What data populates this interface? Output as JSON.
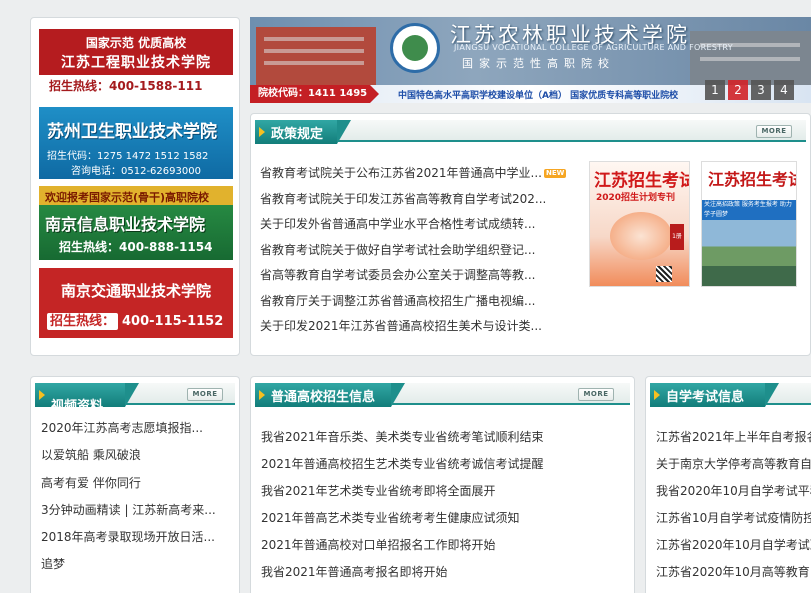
{
  "ads": [
    {
      "line1": "国家示范  优质高校",
      "line2": "江苏工程职业技术学院",
      "line3": "招生热线：400-1588-111"
    },
    {
      "line1": "苏州卫生职业技术学院",
      "line2": "招生代码：1275 1472 1512 1582",
      "line3": "咨询电话：0512-62693000"
    },
    {
      "line1": "欢迎报考国家示范(骨干)高职院校",
      "line2": "南京信息职业技术学院",
      "line3": "招生热线：400-888-1154"
    },
    {
      "line1": "南京交通职业技术学院",
      "line3_tag": "招生热线：",
      "line3": "400-115-1152"
    }
  ],
  "banner": {
    "title_cn": "江苏农林职业技术学院",
    "title_en": "JIANGSU VOCATIONAL COLLEGE OF AGRICULTURE AND FORESTRY",
    "subtitle": "国家示范性高职院校",
    "code_label": "院校代码：1411 1495",
    "tagline": "中国特色高水平高职学校建设单位（A档）   国家优质专科高等职业院校",
    "pages": [
      "1",
      "2",
      "3",
      "4"
    ],
    "active_page": "2"
  },
  "policy": {
    "title": "政策规定",
    "more": "MORE",
    "items": [
      "省教育考试院关于公布江苏省2021年普通高中学业...",
      "省教育考试院关于印发江苏省高等教育自学考试202...",
      "关于印发外省普通高中学业水平合格性考试成绩转...",
      "省教育考试院关于做好自学考试社会助学组织登记...",
      "省高等教育自学考试委员会办公室关于调整高等教...",
      "省教育厅关于调整江苏省普通高校招生广播电视编...",
      "关于印发2021年江苏省普通高校招生美术与设计类..."
    ],
    "new_badge": "NEW",
    "magazine1": {
      "title": "江苏招生考试",
      "year": "2020招生计划专刊",
      "badge": "1册"
    },
    "magazine2": {
      "title": "江苏招生考试",
      "band": "关注高招政策  服务考生报考  助力学子圆梦"
    }
  },
  "video": {
    "title": "视频资料",
    "more": "MORE",
    "items": [
      "2020年江苏高考志愿填报指...",
      "以爱筑船 乘风破浪",
      "高考有爱 伴你同行",
      "3分钟动画精读 | 江苏新高考来...",
      "2018年高考录取现场开放日活...",
      "追梦"
    ]
  },
  "general": {
    "title": "普通高校招生信息",
    "more": "MORE",
    "items": [
      "我省2021年音乐类、美术类专业省统考笔试顺利结束",
      "2021年普通高校招生艺术类专业省统考诚信考试提醒",
      "我省2021年艺术类专业省统考即将全面展开",
      "2021年普高艺术类专业省统考考生健康应试须知",
      "2021年普通高校对口单招报名工作即将开始",
      "我省2021年普通高考报名即将开始"
    ]
  },
  "selfstudy": {
    "title": "自学考试信息",
    "items": [
      "江苏省2021年上半年自考报名",
      "关于南京大学停考高等教育自",
      "我省2020年10月自学考试平稳",
      "江苏省10月自学考试疫情防控",
      "江苏省2020年10月自学考试准",
      "江苏省2020年10月高等教育自"
    ]
  }
}
